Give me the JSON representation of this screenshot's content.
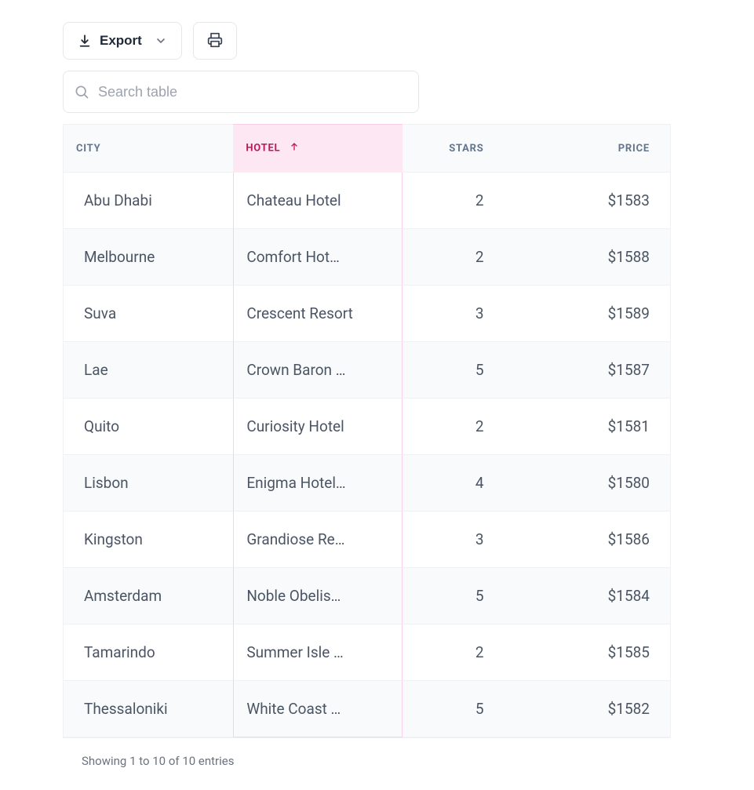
{
  "toolbar": {
    "export_label": "Export"
  },
  "search": {
    "placeholder": "Search table"
  },
  "columns": {
    "city": "City",
    "hotel": "Hotel",
    "stars": "Stars",
    "price": "Price"
  },
  "sorted_column": "hotel",
  "sort_direction": "asc",
  "rows": [
    {
      "city": "Abu Dhabi",
      "hotel": "Chateau Hotel",
      "stars": "2",
      "price": "$1583"
    },
    {
      "city": "Melbourne",
      "hotel": "Comfort Hot…",
      "stars": "2",
      "price": "$1588"
    },
    {
      "city": "Suva",
      "hotel": "Crescent Resort",
      "stars": "3",
      "price": "$1589"
    },
    {
      "city": "Lae",
      "hotel": "Crown Baron …",
      "stars": "5",
      "price": "$1587"
    },
    {
      "city": "Quito",
      "hotel": "Curiosity Hotel",
      "stars": "2",
      "price": "$1581"
    },
    {
      "city": "Lisbon",
      "hotel": "Enigma Hotel…",
      "stars": "4",
      "price": "$1580"
    },
    {
      "city": "Kingston",
      "hotel": "Grandiose Re…",
      "stars": "3",
      "price": "$1586"
    },
    {
      "city": "Amsterdam",
      "hotel": "Noble Obelis…",
      "stars": "5",
      "price": "$1584"
    },
    {
      "city": "Tamarindo",
      "hotel": "Summer Isle …",
      "stars": "2",
      "price": "$1585"
    },
    {
      "city": "Thessaloniki",
      "hotel": "White Coast …",
      "stars": "5",
      "price": "$1582"
    }
  ],
  "footer": {
    "info": "Showing 1 to 10 of 10 entries"
  }
}
